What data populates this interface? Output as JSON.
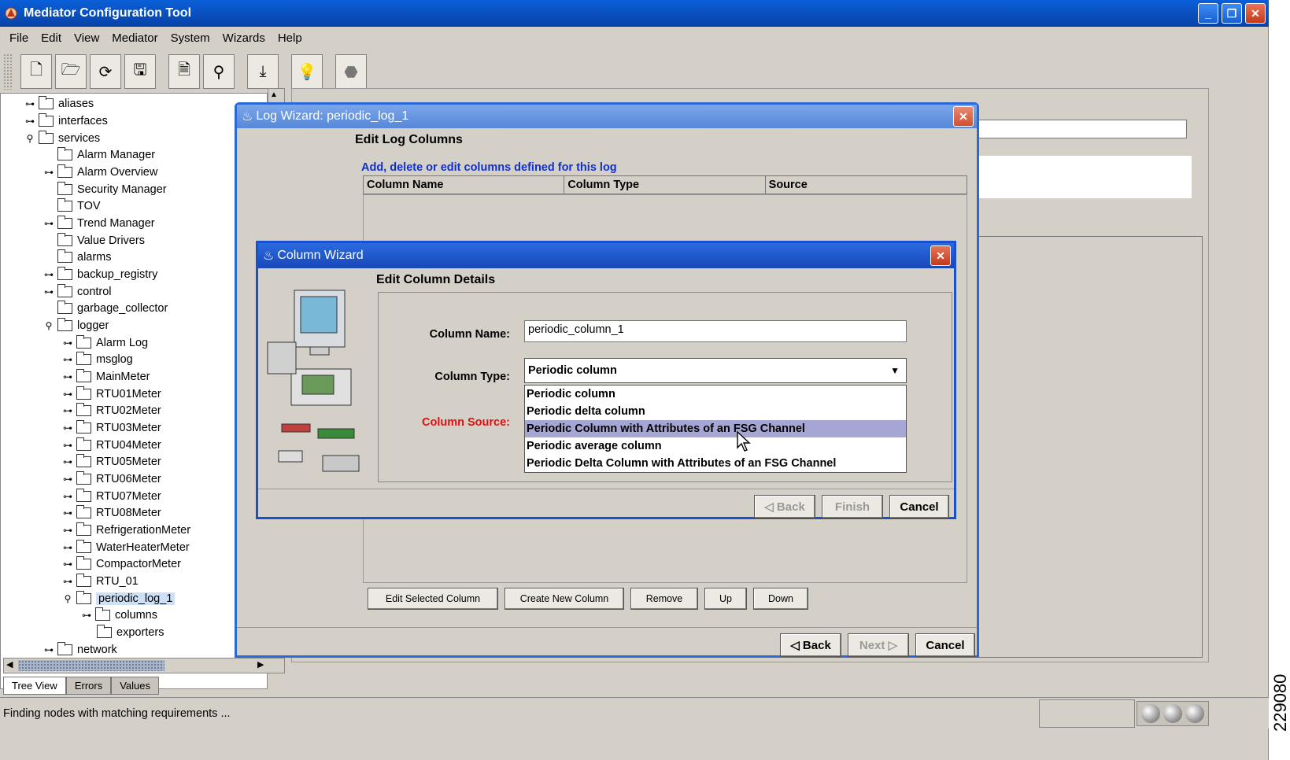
{
  "app": {
    "title": "Mediator Configuration Tool"
  },
  "menu": [
    "File",
    "Edit",
    "View",
    "Mediator",
    "System",
    "Wizards",
    "Help"
  ],
  "toolbar_icons": [
    "new-page-icon",
    "open-folder-icon",
    "refresh-icon",
    "save-icon",
    "new-document-icon",
    "binoculars-icon",
    "download-icon",
    "lightbulb-icon",
    "stop-icon"
  ],
  "tree": {
    "items": [
      {
        "label": "aliases"
      },
      {
        "label": "interfaces"
      },
      {
        "label": "services"
      },
      {
        "label": "Alarm Manager"
      },
      {
        "label": "Alarm Overview"
      },
      {
        "label": "Security Manager"
      },
      {
        "label": "TOV"
      },
      {
        "label": "Trend Manager"
      },
      {
        "label": "Value Drivers"
      },
      {
        "label": "alarms"
      },
      {
        "label": "backup_registry"
      },
      {
        "label": "control"
      },
      {
        "label": "garbage_collector"
      },
      {
        "label": "logger"
      },
      {
        "label": "Alarm Log"
      },
      {
        "label": "msglog"
      },
      {
        "label": "MainMeter"
      },
      {
        "label": "RTU01Meter"
      },
      {
        "label": "RTU02Meter"
      },
      {
        "label": "RTU03Meter"
      },
      {
        "label": "RTU04Meter"
      },
      {
        "label": "RTU05Meter"
      },
      {
        "label": "RTU06Meter"
      },
      {
        "label": "RTU07Meter"
      },
      {
        "label": "RTU08Meter"
      },
      {
        "label": "RefrigerationMeter"
      },
      {
        "label": "WaterHeaterMeter"
      },
      {
        "label": "CompactorMeter"
      },
      {
        "label": "RTU_01"
      },
      {
        "label": "periodic_log_1"
      },
      {
        "label": "columns"
      },
      {
        "label": "exporters"
      },
      {
        "label": "network"
      }
    ]
  },
  "bottom_tabs": [
    "Tree View",
    "Errors",
    "Values"
  ],
  "status": {
    "text": "Finding nodes with matching requirements ..."
  },
  "side_number": "229080",
  "log_wizard": {
    "title": "Log Wizard: periodic_log_1",
    "heading": "Edit Log Columns",
    "note": "Add, delete or edit columns defined for this log",
    "columns": [
      "Column Name",
      "Column Type",
      "Source"
    ],
    "buttons": [
      "Edit Selected Column",
      "Create New Column",
      "Remove",
      "Up",
      "Down"
    ],
    "back": "Back",
    "next": "Next",
    "cancel": "Cancel"
  },
  "column_wizard": {
    "title": "Column Wizard",
    "heading": "Edit Column Details",
    "name_label": "Column Name:",
    "name_value": "periodic_column_1",
    "type_label": "Column Type:",
    "type_value": "Periodic column",
    "source_label": "Column Source:",
    "options": [
      "Periodic column",
      "Periodic delta column",
      "Periodic Column with Attributes of an FSG Channel",
      "Periodic average column",
      "Periodic Delta Column with Attributes of an FSG Channel"
    ],
    "back": "Back",
    "finish": "Finish",
    "cancel": "Cancel"
  }
}
